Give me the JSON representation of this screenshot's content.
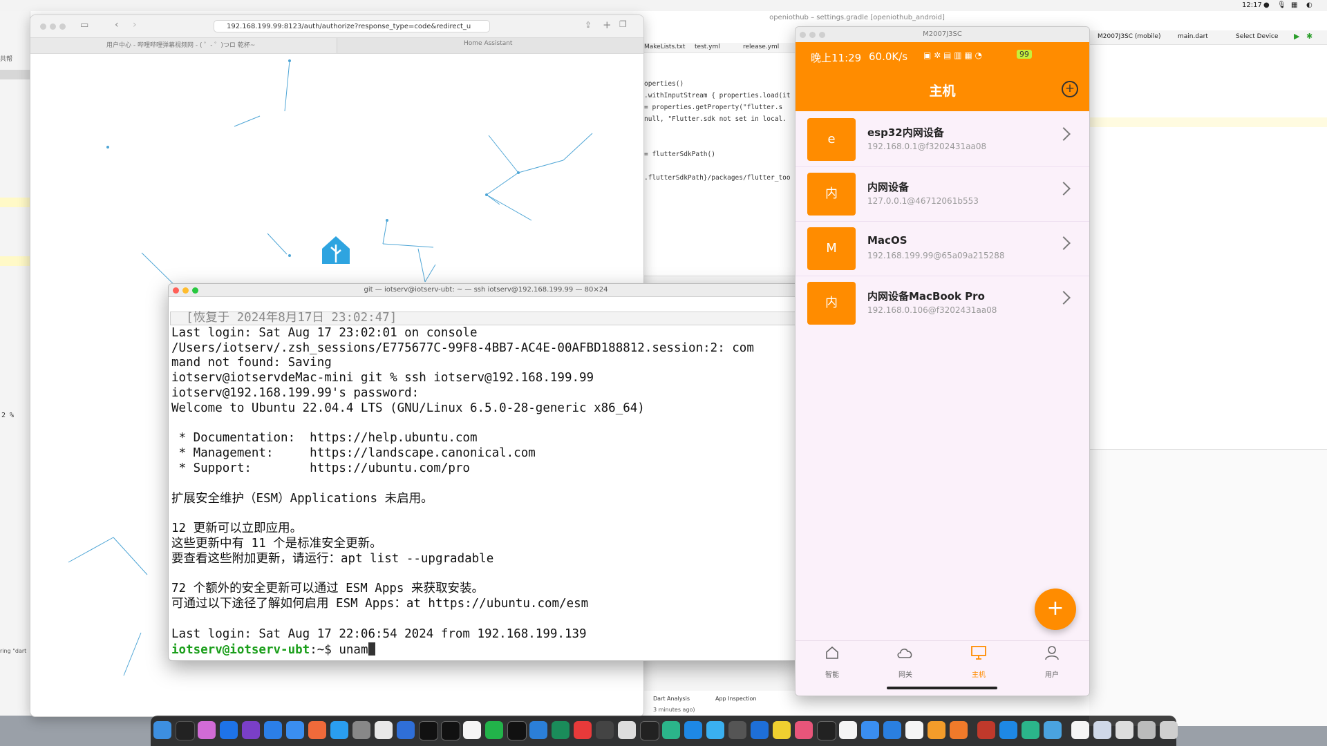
{
  "menubar": {
    "time": "12:17"
  },
  "ide": {
    "window_title": "openiothub – settings.gradle [openiothub_android]",
    "tabs": [
      "MakeLists.txt",
      "test.yml",
      "release.yml"
    ],
    "device_select": "M2007J3SC (mobile)",
    "branch_select": "main.dart",
    "select_device": "Select Device",
    "code_lines": [
      "operties()",
      ".withInputStream { properties.load(it",
      " = properties.getProperty(\"flutter.s",
      " null, \"Flutter.sdk not set in local.",
      "",
      "",
      " = flutterSdkPath()",
      "",
      ".flutterSdkPath}/packages/flutter_too"
    ],
    "bottom_tabs": [
      "Dart Analysis",
      "App Inspection"
    ],
    "status_text": "3 minutes ago)"
  },
  "browser": {
    "url": "192.168.199.99:8123/auth/authorize?response_type=code&redirect_u",
    "tab1": "用户中心 - 哔哩哔哩弹幕视频网 - ( ゜- ゜)つロ 乾杯~",
    "tab2": "Home Assistant"
  },
  "terminal": {
    "title": "git — iotserv@iotserv-ubt: ~ — ssh iotserv@192.168.199.99 — 80×24",
    "restored": "  [恢复于 2024年8月17日 23:02:47]",
    "lines": [
      "Last login: Sat Aug 17 23:02:01 on console",
      "/Users/iotserv/.zsh_sessions/E775677C-99F8-4BB7-AC4E-00AFBD188812.session:2: com",
      "mand not found: Saving",
      "iotserv@iotservdeMac-mini git % ssh iotserv@192.168.199.99",
      "iotserv@192.168.199.99's password:",
      "Welcome to Ubuntu 22.04.4 LTS (GNU/Linux 6.5.0-28-generic x86_64)",
      "",
      " * Documentation:  https://help.ubuntu.com",
      " * Management:     https://landscape.canonical.com",
      " * Support:        https://ubuntu.com/pro",
      "",
      "扩展安全维护（ESM）Applications 未启用。",
      "",
      "12 更新可以立即应用。",
      "这些更新中有 11 个是标准安全更新。",
      "要查看这些附加更新，请运行：apt list --upgradable",
      "",
      "72 个额外的安全更新可以通过 ESM Apps 来获取安装。",
      "可通过以下途径了解如何启用 ESM Apps：at https://ubuntu.com/esm",
      "",
      "Last login: Sat Aug 17 22:06:54 2024 from 192.168.199.139"
    ],
    "prompt_user": "iotserv@iotserv-ubt",
    "prompt_path": ":~$ ",
    "command": "unam"
  },
  "phone": {
    "window_title": "M2007J3SC",
    "status_time": "晚上11:29",
    "status_speed": "60.0K/s",
    "battery": "99",
    "app_title": "主机",
    "devices": [
      {
        "avatar": "e",
        "name": "esp32内网设备",
        "sub": "192.168.0.1@f3202431aa08"
      },
      {
        "avatar": "内",
        "name": "内网设备",
        "sub": "127.0.0.1@46712061b553"
      },
      {
        "avatar": "M",
        "name": "MacOS",
        "sub": "192.168.199.99@65a09a215288"
      },
      {
        "avatar": "内",
        "name": "内网设备MacBook Pro",
        "sub": "192.168.0.106@f3202431aa08"
      }
    ],
    "nav": [
      {
        "label": "智能",
        "icon": "home-icon"
      },
      {
        "label": "网关",
        "icon": "cloud-icon"
      },
      {
        "label": "主机",
        "icon": "monitor-icon"
      },
      {
        "label": "用户",
        "icon": "user-icon"
      }
    ]
  },
  "left_fragments": {
    "top_text": "共帮",
    "prompt_fragment": "2 %",
    "bottom_text": "ring \"dart"
  },
  "colors": {
    "accent": "#ff8c00",
    "prompt_green": "#1a9e1a"
  }
}
